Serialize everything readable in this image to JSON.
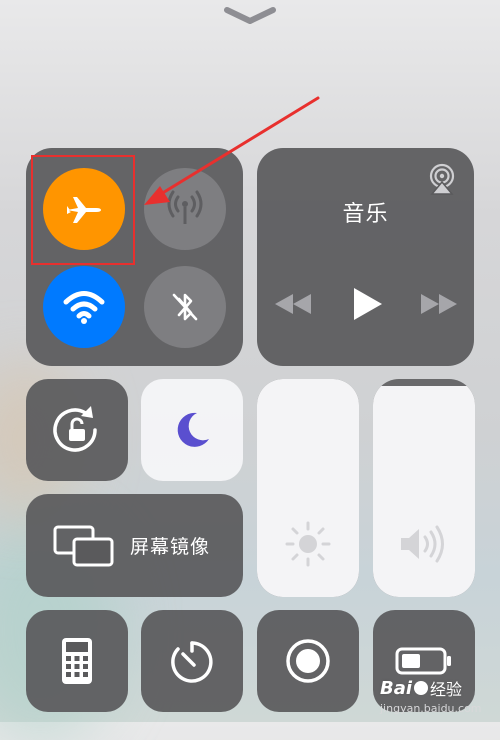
{
  "colors": {
    "airplane_active": "#FF9500",
    "wifi_active": "#007AFF",
    "annotation_red": "#E8302E",
    "moon": "#5A4FCF"
  },
  "grabber": {
    "icon": "chevron-down-icon"
  },
  "connectivity": {
    "airplane": {
      "icon": "airplane-icon",
      "state": "on"
    },
    "cellular": {
      "icon": "cellular-antenna-icon",
      "state": "off"
    },
    "wifi": {
      "icon": "wifi-icon",
      "state": "on"
    },
    "bluetooth": {
      "icon": "bluetooth-off-icon",
      "state": "off"
    }
  },
  "music": {
    "title": "音乐",
    "airplay_icon": "airplay-icon",
    "prev_icon": "rewind-icon",
    "play_icon": "play-icon",
    "next_icon": "fast-forward-icon"
  },
  "controls": {
    "rotation_lock_icon": "rotation-lock-icon",
    "do_not_disturb_icon": "moon-icon",
    "screen_mirroring_label": "屏幕镜像",
    "screen_mirroring_icon": "screen-mirroring-icon"
  },
  "sliders": {
    "brightness": {
      "icon": "sun-icon",
      "level": 1.0
    },
    "volume": {
      "icon": "speaker-icon",
      "level": 0.97
    }
  },
  "bottom_row": {
    "calculator_icon": "calculator-icon",
    "timer_icon": "timer-icon",
    "screen_record_icon": "screen-record-icon",
    "low_power_icon": "battery-icon"
  },
  "watermark": {
    "brand_prefix": "Bai",
    "brand_suffix": "经验",
    "url": "jingyan.baidu.com"
  }
}
